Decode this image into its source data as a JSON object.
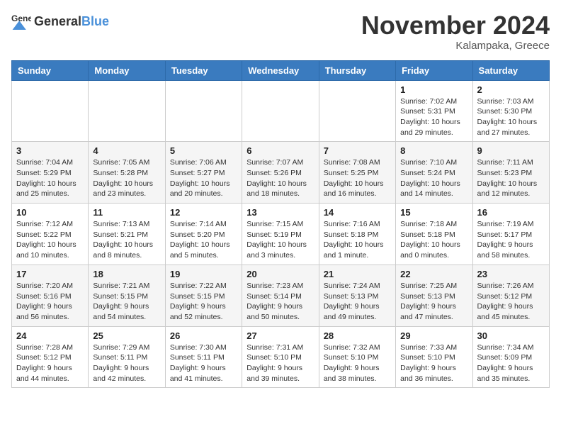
{
  "header": {
    "logo_general": "General",
    "logo_blue": "Blue",
    "month_title": "November 2024",
    "location": "Kalampaka, Greece"
  },
  "calendar": {
    "days_of_week": [
      "Sunday",
      "Monday",
      "Tuesday",
      "Wednesday",
      "Thursday",
      "Friday",
      "Saturday"
    ],
    "weeks": [
      [
        {
          "day": "",
          "info": ""
        },
        {
          "day": "",
          "info": ""
        },
        {
          "day": "",
          "info": ""
        },
        {
          "day": "",
          "info": ""
        },
        {
          "day": "",
          "info": ""
        },
        {
          "day": "1",
          "info": "Sunrise: 7:02 AM\nSunset: 5:31 PM\nDaylight: 10 hours and 29 minutes."
        },
        {
          "day": "2",
          "info": "Sunrise: 7:03 AM\nSunset: 5:30 PM\nDaylight: 10 hours and 27 minutes."
        }
      ],
      [
        {
          "day": "3",
          "info": "Sunrise: 7:04 AM\nSunset: 5:29 PM\nDaylight: 10 hours and 25 minutes."
        },
        {
          "day": "4",
          "info": "Sunrise: 7:05 AM\nSunset: 5:28 PM\nDaylight: 10 hours and 23 minutes."
        },
        {
          "day": "5",
          "info": "Sunrise: 7:06 AM\nSunset: 5:27 PM\nDaylight: 10 hours and 20 minutes."
        },
        {
          "day": "6",
          "info": "Sunrise: 7:07 AM\nSunset: 5:26 PM\nDaylight: 10 hours and 18 minutes."
        },
        {
          "day": "7",
          "info": "Sunrise: 7:08 AM\nSunset: 5:25 PM\nDaylight: 10 hours and 16 minutes."
        },
        {
          "day": "8",
          "info": "Sunrise: 7:10 AM\nSunset: 5:24 PM\nDaylight: 10 hours and 14 minutes."
        },
        {
          "day": "9",
          "info": "Sunrise: 7:11 AM\nSunset: 5:23 PM\nDaylight: 10 hours and 12 minutes."
        }
      ],
      [
        {
          "day": "10",
          "info": "Sunrise: 7:12 AM\nSunset: 5:22 PM\nDaylight: 10 hours and 10 minutes."
        },
        {
          "day": "11",
          "info": "Sunrise: 7:13 AM\nSunset: 5:21 PM\nDaylight: 10 hours and 8 minutes."
        },
        {
          "day": "12",
          "info": "Sunrise: 7:14 AM\nSunset: 5:20 PM\nDaylight: 10 hours and 5 minutes."
        },
        {
          "day": "13",
          "info": "Sunrise: 7:15 AM\nSunset: 5:19 PM\nDaylight: 10 hours and 3 minutes."
        },
        {
          "day": "14",
          "info": "Sunrise: 7:16 AM\nSunset: 5:18 PM\nDaylight: 10 hours and 1 minute."
        },
        {
          "day": "15",
          "info": "Sunrise: 7:18 AM\nSunset: 5:18 PM\nDaylight: 10 hours and 0 minutes."
        },
        {
          "day": "16",
          "info": "Sunrise: 7:19 AM\nSunset: 5:17 PM\nDaylight: 9 hours and 58 minutes."
        }
      ],
      [
        {
          "day": "17",
          "info": "Sunrise: 7:20 AM\nSunset: 5:16 PM\nDaylight: 9 hours and 56 minutes."
        },
        {
          "day": "18",
          "info": "Sunrise: 7:21 AM\nSunset: 5:15 PM\nDaylight: 9 hours and 54 minutes."
        },
        {
          "day": "19",
          "info": "Sunrise: 7:22 AM\nSunset: 5:15 PM\nDaylight: 9 hours and 52 minutes."
        },
        {
          "day": "20",
          "info": "Sunrise: 7:23 AM\nSunset: 5:14 PM\nDaylight: 9 hours and 50 minutes."
        },
        {
          "day": "21",
          "info": "Sunrise: 7:24 AM\nSunset: 5:13 PM\nDaylight: 9 hours and 49 minutes."
        },
        {
          "day": "22",
          "info": "Sunrise: 7:25 AM\nSunset: 5:13 PM\nDaylight: 9 hours and 47 minutes."
        },
        {
          "day": "23",
          "info": "Sunrise: 7:26 AM\nSunset: 5:12 PM\nDaylight: 9 hours and 45 minutes."
        }
      ],
      [
        {
          "day": "24",
          "info": "Sunrise: 7:28 AM\nSunset: 5:12 PM\nDaylight: 9 hours and 44 minutes."
        },
        {
          "day": "25",
          "info": "Sunrise: 7:29 AM\nSunset: 5:11 PM\nDaylight: 9 hours and 42 minutes."
        },
        {
          "day": "26",
          "info": "Sunrise: 7:30 AM\nSunset: 5:11 PM\nDaylight: 9 hours and 41 minutes."
        },
        {
          "day": "27",
          "info": "Sunrise: 7:31 AM\nSunset: 5:10 PM\nDaylight: 9 hours and 39 minutes."
        },
        {
          "day": "28",
          "info": "Sunrise: 7:32 AM\nSunset: 5:10 PM\nDaylight: 9 hours and 38 minutes."
        },
        {
          "day": "29",
          "info": "Sunrise: 7:33 AM\nSunset: 5:10 PM\nDaylight: 9 hours and 36 minutes."
        },
        {
          "day": "30",
          "info": "Sunrise: 7:34 AM\nSunset: 5:09 PM\nDaylight: 9 hours and 35 minutes."
        }
      ]
    ]
  }
}
